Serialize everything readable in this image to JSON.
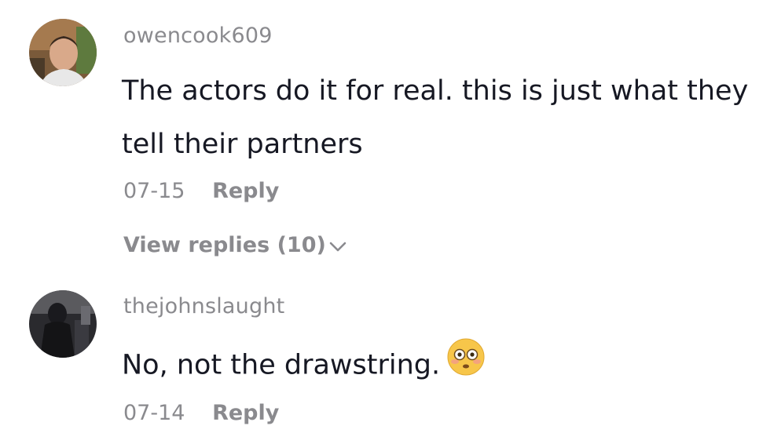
{
  "comments": [
    {
      "username": "owencook609",
      "text": "The actors do it for real. this is just what they tell their partners",
      "date": "07-15",
      "reply_label": "Reply",
      "view_replies_label": "View replies (10)"
    },
    {
      "username": "thejohnslaught",
      "text": "No, not the drawstring.",
      "emoji": "flushed-face",
      "date": "07-14",
      "reply_label": "Reply"
    }
  ]
}
